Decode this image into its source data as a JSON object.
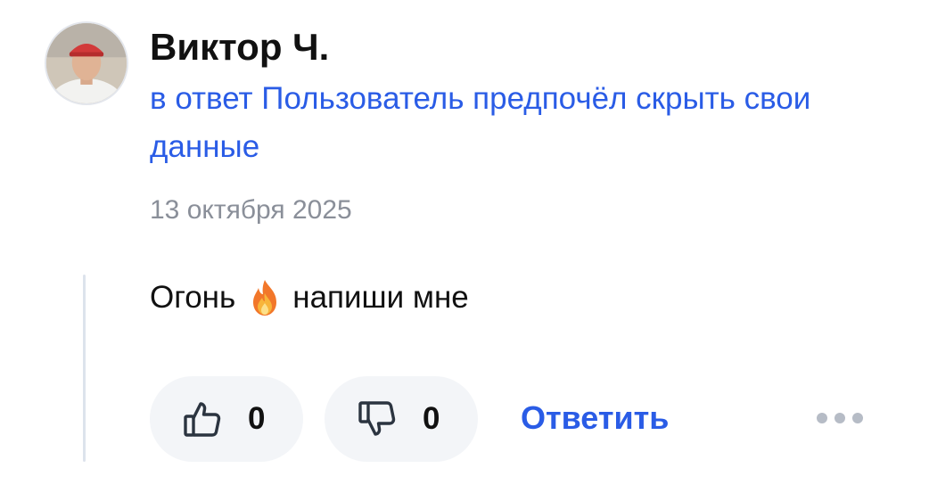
{
  "comment": {
    "author": "Виктор Ч.",
    "reply_to": "в ответ Пользователь предпочёл скрыть свои данные",
    "date": "13 октября 2025",
    "text_before_emoji": "Огонь",
    "emoji": "fire-emoji",
    "text_after_emoji": "напиши мне",
    "likes": "0",
    "dislikes": "0",
    "reply_label": "Ответить",
    "more_icon": "more-dots-icon"
  },
  "colors": {
    "link": "#2a5ce6",
    "text": "#111111",
    "muted": "#8a8f99",
    "button_bg": "#f3f5f8",
    "thread_line": "#dde3ec"
  }
}
